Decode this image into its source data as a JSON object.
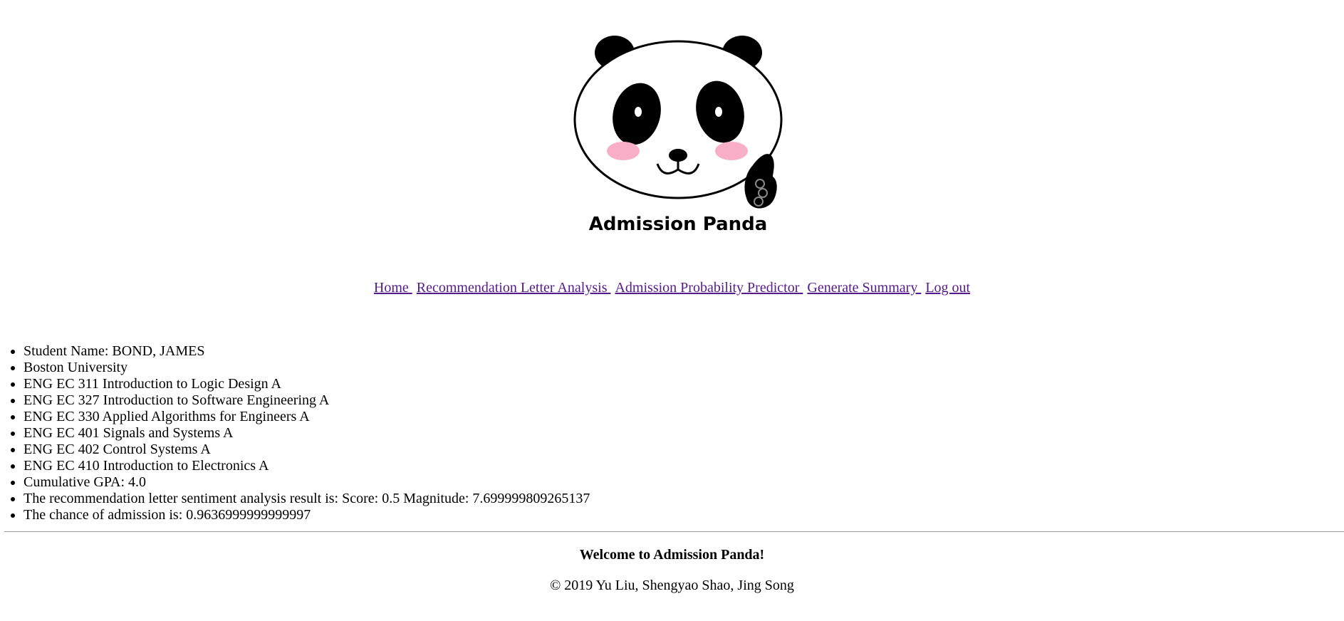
{
  "logo": {
    "icon": "panda-thumbs-up-icon",
    "text": "Admission Panda"
  },
  "nav": {
    "links": [
      {
        "label": "Home "
      },
      {
        "label": "Recommendation Letter Analysis "
      },
      {
        "label": "Admission Probability Predictor "
      },
      {
        "label": "Generate Summary "
      },
      {
        "label": "Log out"
      }
    ],
    "link_color": "#551a8b"
  },
  "info": {
    "items": [
      "Student Name: BOND, JAMES",
      "Boston University",
      "ENG EC 311 Introduction to Logic Design A",
      "ENG EC 327 Introduction to Software Engineering A",
      "ENG EC 330 Applied Algorithms for Engineers A",
      "ENG EC 401 Signals and Systems A",
      "ENG EC 402 Control Systems A",
      "ENG EC 410 Introduction to Electronics A",
      "Cumulative GPA: 4.0",
      "The recommendation letter sentiment analysis result is: Score: 0.5 Magnitude: 7.699999809265137",
      "The chance of admission is: 0.9636999999999997"
    ]
  },
  "footer": {
    "welcome": "Welcome to Admission Panda!",
    "copyright": "© 2019 Yu Liu, Shengyao Shao, Jing Song"
  },
  "colors": {
    "cheek": "#f9aec8",
    "divider": "#9a9a9a"
  }
}
